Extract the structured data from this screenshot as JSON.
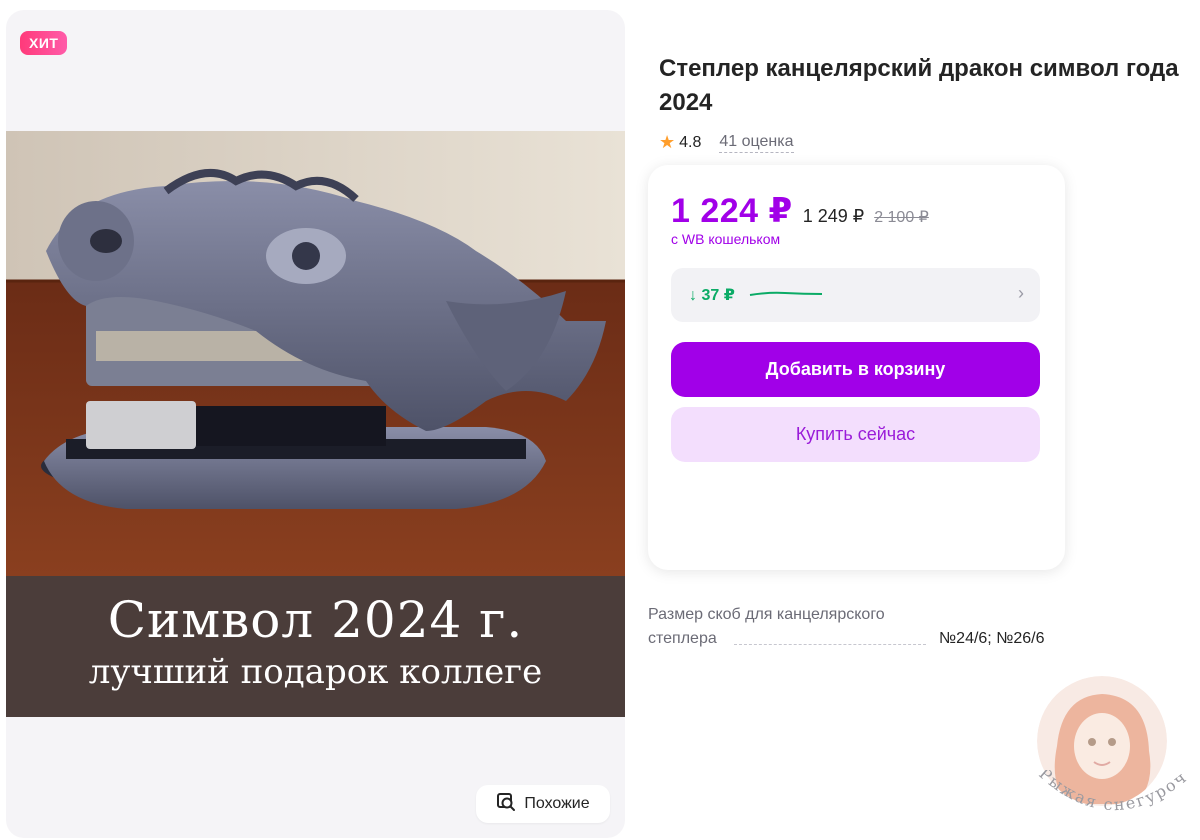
{
  "gallery": {
    "badge": "ХИТ",
    "caption_title": "Символ  2024 г.",
    "caption_sub": "лучший подарок коллеге",
    "similar_label": "Похожие"
  },
  "product": {
    "title": "Степлер канцелярский дракон символ года 2024",
    "rating": "4.8",
    "reviews": "41 оценка"
  },
  "pricing": {
    "wallet_price": "1 224 ₽",
    "price": "1 249 ₽",
    "old_price": "2 100 ₽",
    "wallet_note": "с WB кошельком",
    "history_delta": "↓ 37 ₽"
  },
  "actions": {
    "add_to_cart": "Добавить в корзину",
    "buy_now": "Купить сейчас"
  },
  "specs": {
    "staple_label": "Размер скоб для канцелярского степлера",
    "staple_value": "№24/6; №26/6"
  },
  "watermark": {
    "text": "Рыжая снегурочка"
  },
  "colors": {
    "accent": "#a100e8",
    "accent_light": "#f3defd",
    "badge": "#ff3a7a",
    "positive": "#0bab66",
    "star": "#ff9e2c"
  }
}
